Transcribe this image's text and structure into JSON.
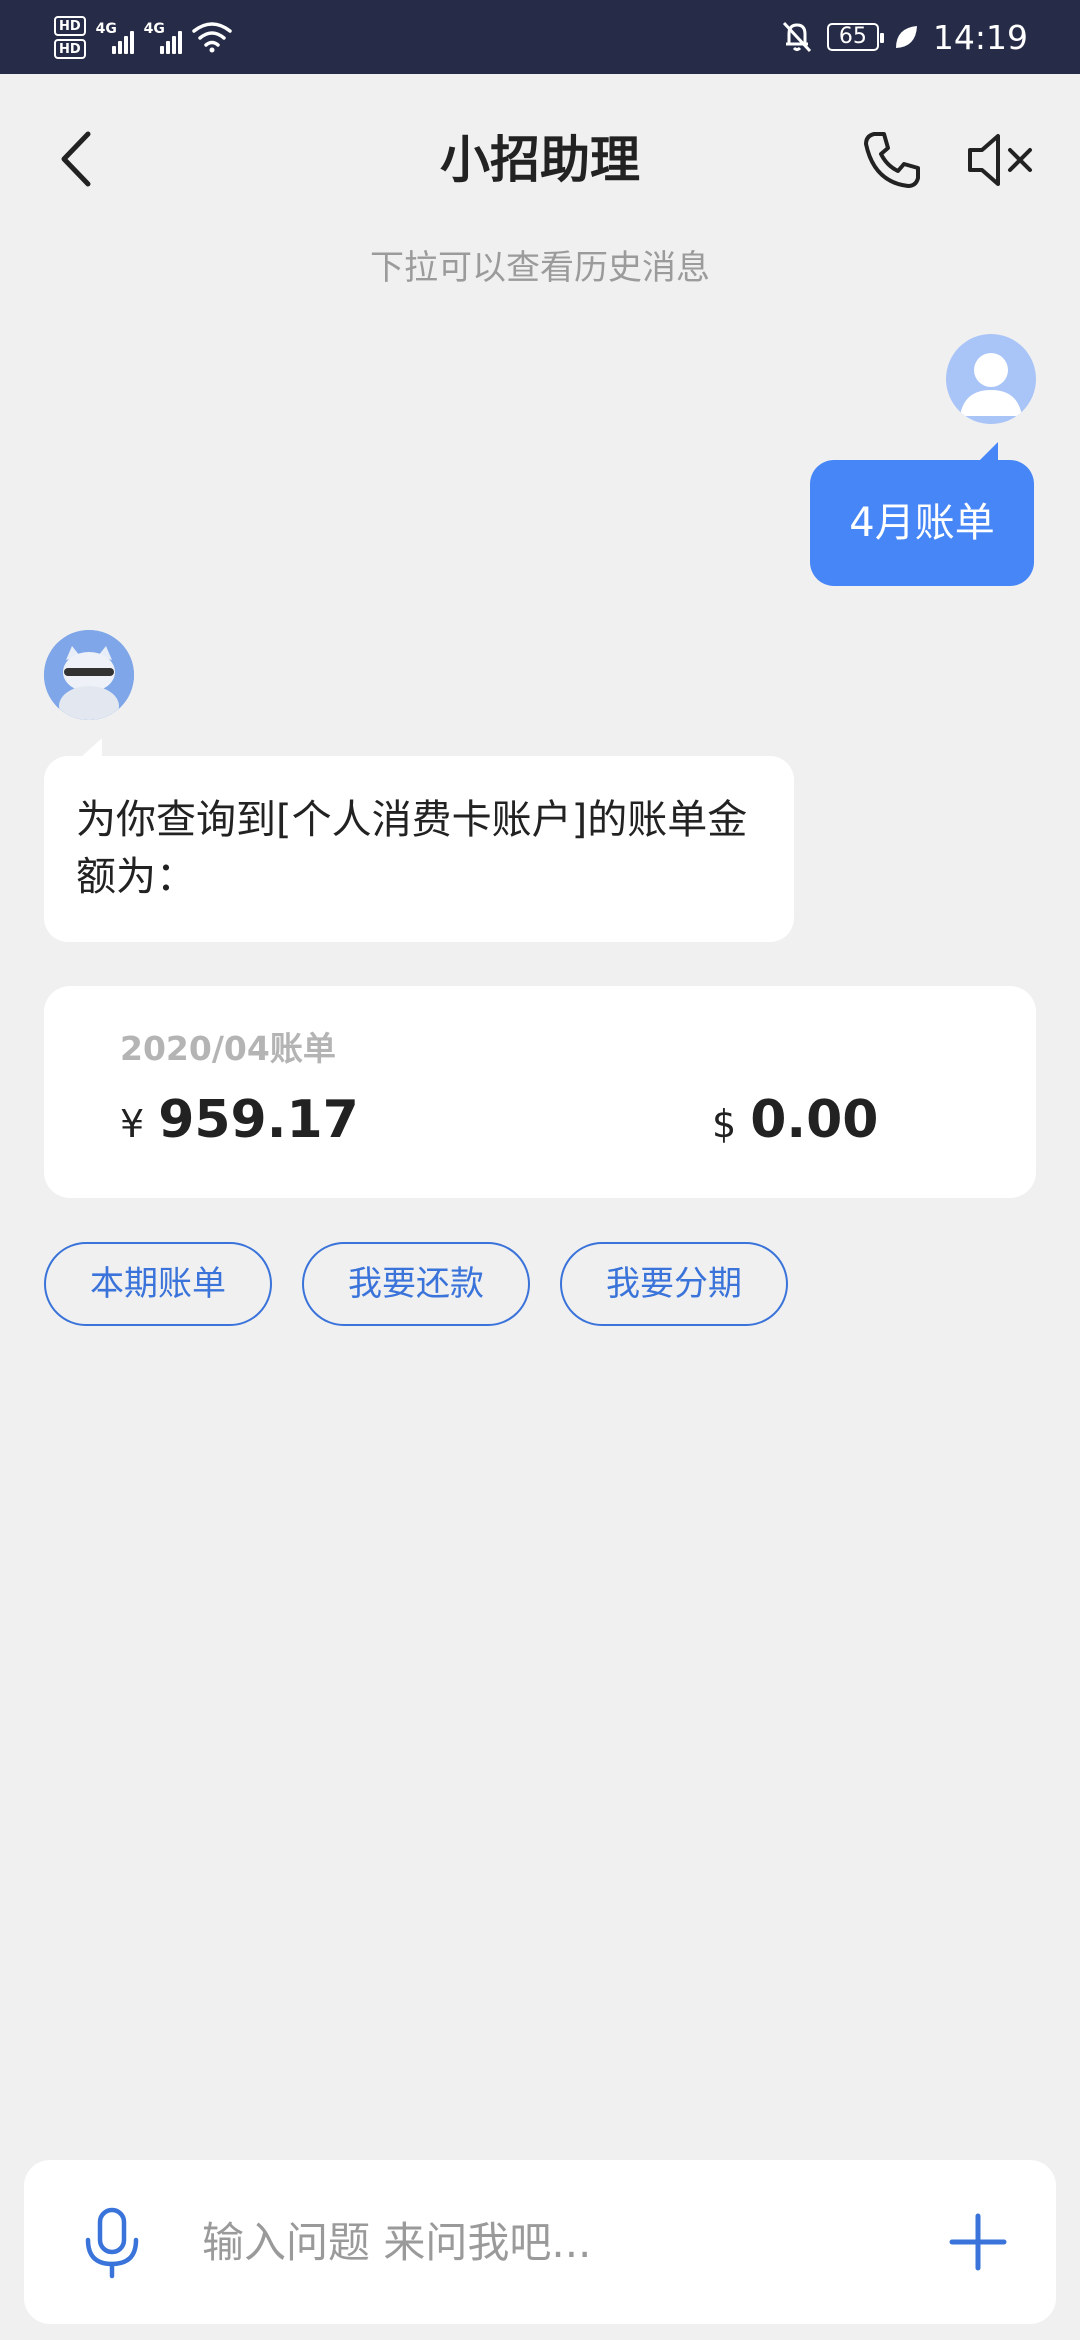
{
  "status_bar": {
    "hd1": "HD",
    "hd2": "HD",
    "net1": "4G",
    "net2": "4G",
    "battery": "65",
    "time": "14:19"
  },
  "nav": {
    "title": "小招助理"
  },
  "history_hint": "下拉可以查看历史消息",
  "messages": {
    "user_text": "4月账单",
    "bot_text": "为你查询到[个人消费卡账户]的账单金额为："
  },
  "bill": {
    "period": "2020/04账单",
    "cny_symbol": "¥",
    "cny_amount": "959.17",
    "usd_symbol": "$",
    "usd_amount": "0.00"
  },
  "quick_replies": [
    "本期账单",
    "我要还款",
    "我要分期"
  ],
  "input": {
    "placeholder": "输入问题 来问我吧..."
  },
  "colors": {
    "status_bar_bg": "#262c48",
    "accent": "#4786f6",
    "chip_border": "#3a73d9",
    "page_bg": "#f0f0f1"
  },
  "icons": [
    "back-icon",
    "phone-icon",
    "mute-icon",
    "mic-icon",
    "plus-icon",
    "silent-bell-icon",
    "leaf-icon",
    "wifi-icon"
  ]
}
